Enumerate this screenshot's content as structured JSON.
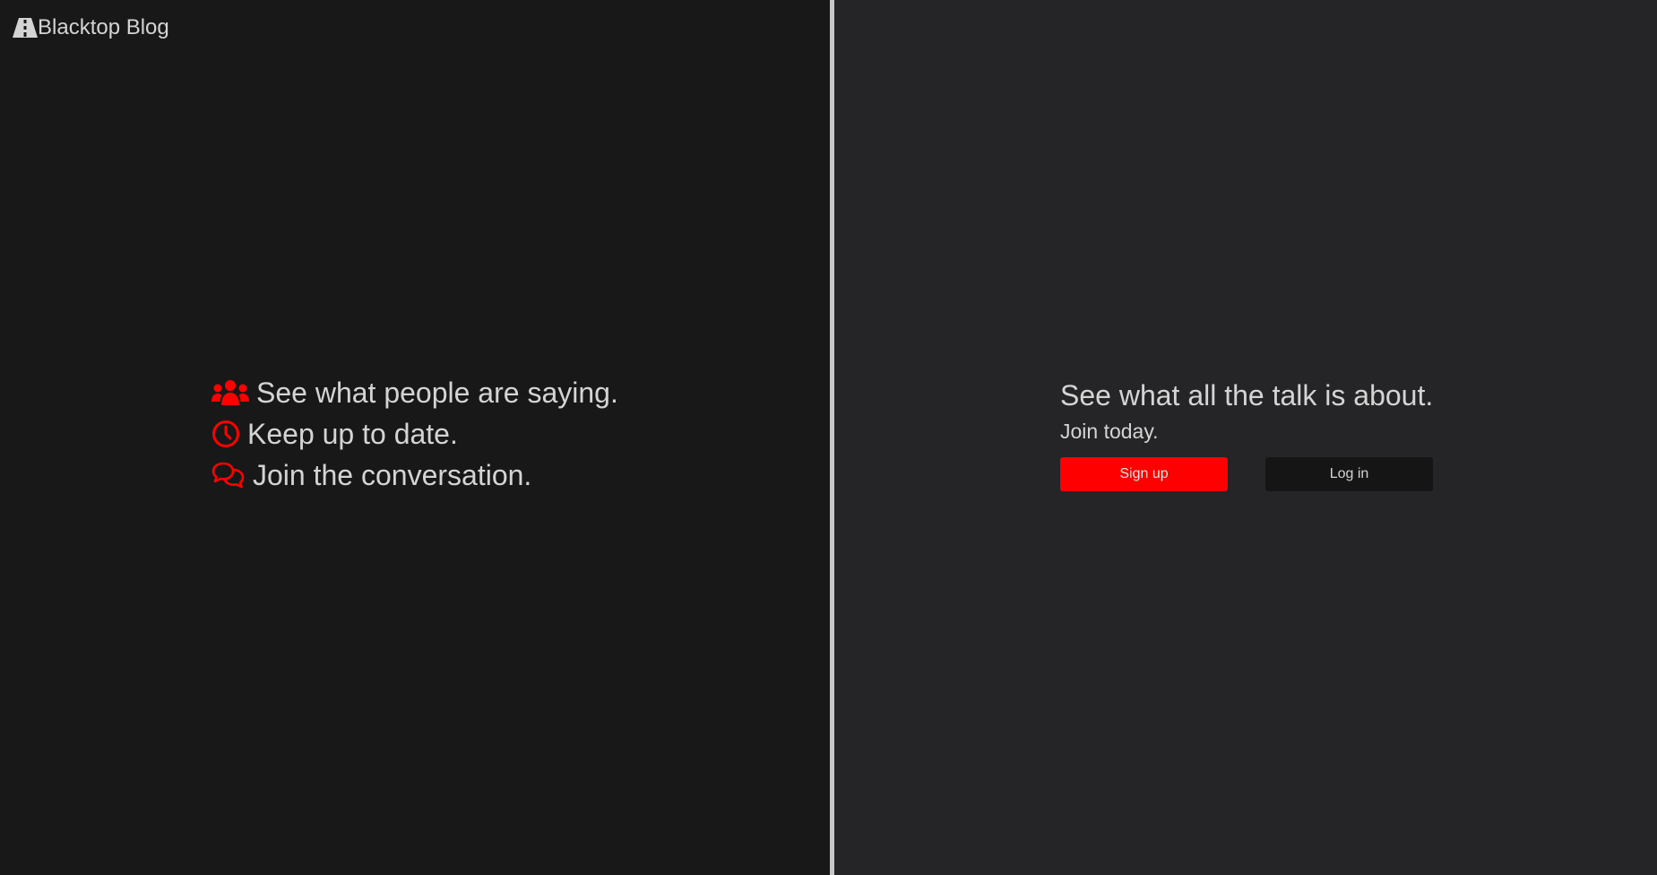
{
  "brand": {
    "name": "Blacktop Blog",
    "icon": "road-icon"
  },
  "features": [
    {
      "icon": "users-icon",
      "text": "See what people are saying."
    },
    {
      "icon": "clock-icon",
      "text": "Keep up to date."
    },
    {
      "icon": "comments-icon",
      "text": "Join the conversation."
    }
  ],
  "cta": {
    "title": "See what all the talk is about.",
    "subtitle": "Join today.",
    "signup_label": "Sign up",
    "login_label": "Log in"
  },
  "colors": {
    "accent": "#ff0000",
    "left_bg": "#181819",
    "right_bg": "#252527",
    "text": "#d4d4d4"
  }
}
